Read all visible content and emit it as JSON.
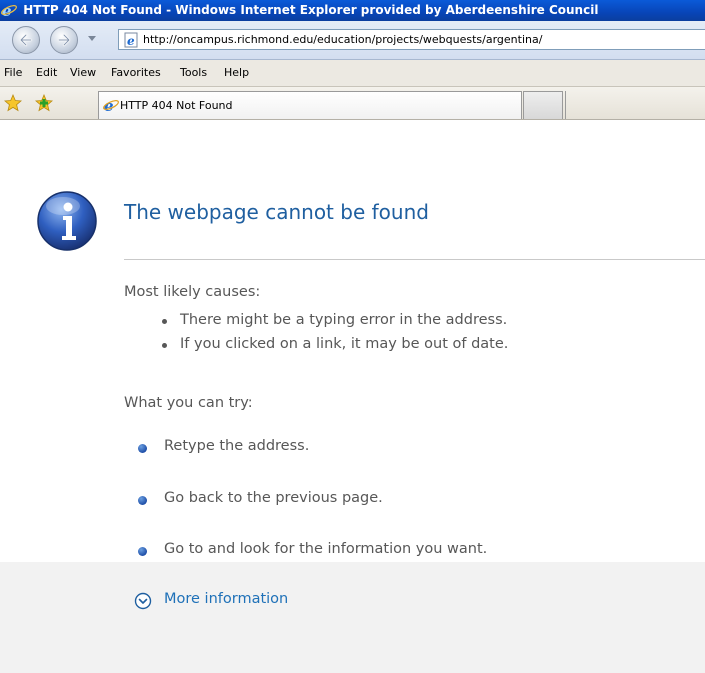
{
  "window": {
    "title": "HTTP 404 Not Found - Windows Internet Explorer provided by Aberdeenshire Council"
  },
  "address_bar": {
    "url": "http://oncampus.richmond.edu/education/projects/webquests/argentina/"
  },
  "menu": {
    "items": [
      "File",
      "Edit",
      "View",
      "Favorites",
      "Tools",
      "Help"
    ]
  },
  "tabs": [
    {
      "label": "HTTP 404 Not Found"
    }
  ],
  "page": {
    "heading": "The webpage cannot be found",
    "causes_label": "Most likely causes:",
    "causes": [
      "There might be a typing error in the address.",
      "If you clicked on a link, it may be out of date."
    ],
    "try_label": "What you can try:",
    "try_items": [
      "Retype the address.",
      "Go back to the previous page.",
      "Go to  and look for the information you want."
    ],
    "more_info": "More information"
  },
  "colors": {
    "heading": "#1f5fa0",
    "body_text": "#575757",
    "link": "#1f71b8",
    "titlebar": "#0845b8"
  },
  "icons": {
    "title": "ie-logo-icon",
    "back": "back-arrow-icon",
    "forward": "forward-arrow-icon",
    "page": "ie-page-icon",
    "favorites": "favorites-star-icon",
    "add_favorite": "add-favorite-icon",
    "info": "info-icon",
    "expand": "expand-chevron-icon"
  }
}
